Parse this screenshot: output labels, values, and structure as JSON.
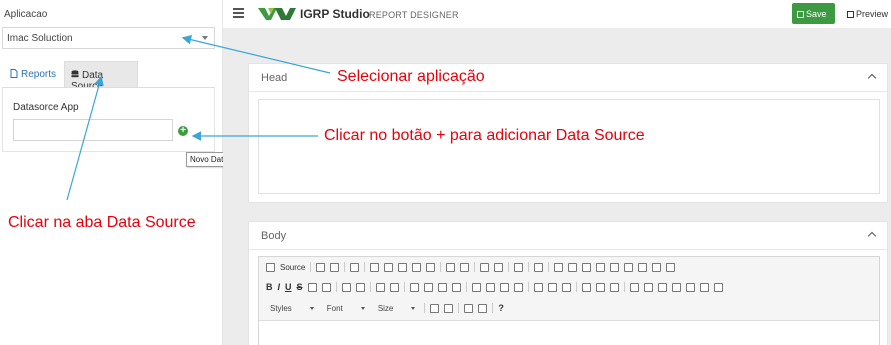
{
  "sidebar": {
    "app_label": "Aplicacao",
    "app_selected": "Imac Soluction",
    "tabs": [
      {
        "label": "Reports",
        "icon": "file-icon"
      },
      {
        "label": "Data Source",
        "icon": "database-icon"
      }
    ],
    "datasource_label": "Datasorce App",
    "add_tooltip": "Novo Data Source"
  },
  "topbar": {
    "brand": "IGRP Studio",
    "subtitle": "REPORT DESIGNER",
    "save_label": "Save",
    "preview_label": "Preview"
  },
  "main": {
    "head_title": "Head",
    "body_title": "Body",
    "toolbar": {
      "source_label": "Source",
      "bold": "B",
      "italic": "I",
      "underline": "U",
      "strike": "S",
      "styles_label": "Styles",
      "font_label": "Font",
      "size_label": "Size",
      "help": "?"
    }
  },
  "annotations": {
    "select_app": "Selecionar aplicação",
    "click_plus": "Clicar no botão + para adicionar Data Source",
    "click_tab": "Clicar na aba Data Source"
  },
  "colors": {
    "brand_green": "#3d9a43",
    "annotation_red": "#e8000b",
    "arrow_blue": "#3aa6d8",
    "link_blue": "#2a73b8"
  }
}
